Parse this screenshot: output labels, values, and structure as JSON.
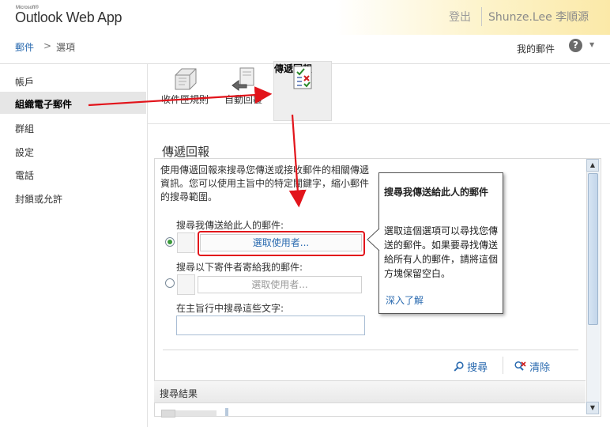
{
  "header": {
    "brand_small": "Microsoft®",
    "brand": "Outlook Web App",
    "signout": "登出",
    "user": "Shunze.Lee 李順源"
  },
  "breadcrumb": {
    "mail": "郵件",
    "separator": ">",
    "options": "選項",
    "my_mail": "我的郵件",
    "help": "?",
    "help_menu": "▼"
  },
  "sidebar": {
    "items": [
      {
        "label": "帳戶"
      },
      {
        "label": "組織電子郵件",
        "selected": true
      },
      {
        "label": "群組"
      },
      {
        "label": "設定"
      },
      {
        "label": "電話"
      },
      {
        "label": "封鎖或允許"
      }
    ]
  },
  "toolbar": {
    "items": [
      {
        "label": "收件匣規則",
        "icon": "inbox-rules-icon"
      },
      {
        "label": "自動回覆",
        "icon": "auto-reply-icon"
      },
      {
        "label": "傳遞回報",
        "icon": "delivery-report-icon",
        "selected": true
      }
    ]
  },
  "main": {
    "title": "傳遞回報",
    "description": "使用傳遞回報來搜尋您傳送或接收郵件的相關傳遞資訊。您可以使用主旨中的特定關鍵字，縮小郵件的搜尋範圍。",
    "sent_to_label": "搜尋我傳送給此人的郵件:",
    "sent_to_button": "選取使用者...",
    "received_from_label": "搜尋以下寄件者寄給我的郵件:",
    "received_from_button": "選取使用者...",
    "keyword_label": "在主旨行中搜尋這些文字:",
    "keyword_value": "",
    "search_button": "搜尋",
    "clear_button": "清除",
    "results_label": "搜尋結果"
  },
  "callout": {
    "title": "搜尋我傳送給此人的郵件",
    "body": "選取這個選項可以尋找您傳送的郵件。如果要尋找傳送給所有人的郵件，請將這個方塊保留空白。",
    "link": "深入了解"
  },
  "colors": {
    "annotation_red": "#e2141b",
    "link_blue": "#2b6bb0",
    "radio_selected": "#3a9a3a"
  }
}
